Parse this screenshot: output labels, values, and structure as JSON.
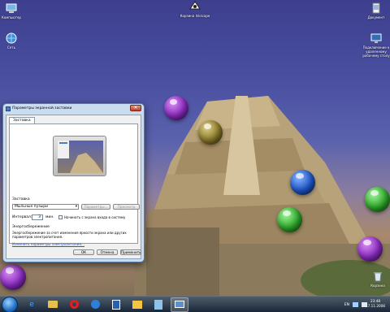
{
  "desktop": {
    "icons": [
      {
        "label": "Компьютер",
        "icon": "computer-icon"
      },
      {
        "label": "Сеть",
        "icon": "network-icon"
      },
      {
        "label": "Корзина Inkscape",
        "icon": "inkscape-icon"
      },
      {
        "label": "Документ",
        "icon": "document-icon"
      },
      {
        "label": "Подключение к удаленному рабочему столу",
        "icon": "remote-desktop-icon"
      },
      {
        "label": "Корзина",
        "icon": "recycle-bin-icon"
      }
    ]
  },
  "dialog": {
    "title": "Параметры экранной заставки",
    "close_glyph": "✕",
    "tab_label": "Заставка",
    "screensaver_label": "Заставка",
    "screensaver_value": "Мыльные пузыри",
    "params_button": "Параметры...",
    "preview_button": "Просмотр",
    "interval_label": "Интервал:",
    "interval_value": "3",
    "interval_unit": "мин.",
    "resume_logon_label": "Начинать с экрана входа в систему",
    "power_section_title": "Энергосбережение",
    "power_description": "Энергосбережение за счет изменения яркости экрана или других параметров электропитания.",
    "power_link": "Изменить параметры электропитания...",
    "ok_button": "ОК",
    "cancel_button": "Отмена",
    "apply_button": "Применить"
  },
  "taskbar": {
    "language": "EN",
    "time": "23:48",
    "date": "17.11.2008"
  },
  "colors": {
    "bubble_purple": "#8a2bbf",
    "bubble_olive": "#8a7a2a",
    "bubble_blue": "#1f57c9",
    "bubble_green": "#2fa82a"
  }
}
